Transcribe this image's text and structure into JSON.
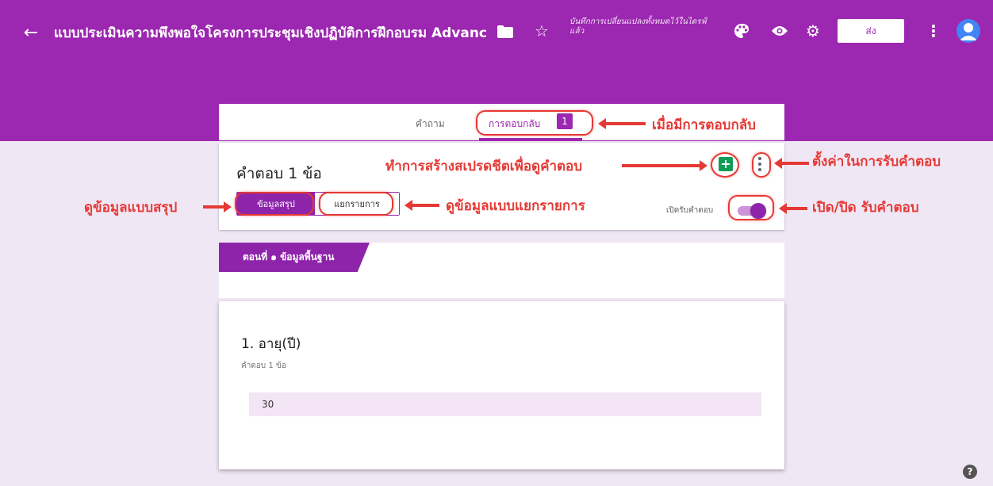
{
  "header": {
    "title": "แบบประเมินความพึงพอใจโครงการประชุมเชิงปฏิบัติการฝึกอบรม Advanc",
    "save_status": "บันทึกการเปลี่ยนแปลงทั้งหมดไว้ในไดรฟ์แล้ว",
    "send_label": "ส่ง",
    "background_color": "#9c27b0"
  },
  "tabs": {
    "questions_label": "คำถาม",
    "responses_label": "การตอบกลับ",
    "responses_count": "1"
  },
  "responses": {
    "count_label": "คำตอบ 1 ข้อ",
    "summary_label": "ข้อมูลสรุป",
    "individual_label": "แยกรายการ",
    "accepting_label": "เปิดรับคำตอบ",
    "accepting": true
  },
  "section": {
    "title": "ตอนที่ ๑ ข้อมูลพื้นฐาน"
  },
  "question": {
    "title": "1. อายุ(ปี)",
    "count_label": "คำตอบ 1 ข้อ",
    "answers": [
      "30"
    ]
  },
  "annotations": {
    "responses_tab": "เมื่อมีการตอบกลับ",
    "create_sheet": "ทำการสร้างสเปรดชีตเพื่อดูคำตอบ",
    "settings": "ตั้งค่าในการรับคำตอบ",
    "summary": "ดูข้อมูลแบบสรุป",
    "individual": "ดูข้อมูลแบบแยกรายการ",
    "toggle": "เปิด/ปิด รับคำตอบ"
  }
}
